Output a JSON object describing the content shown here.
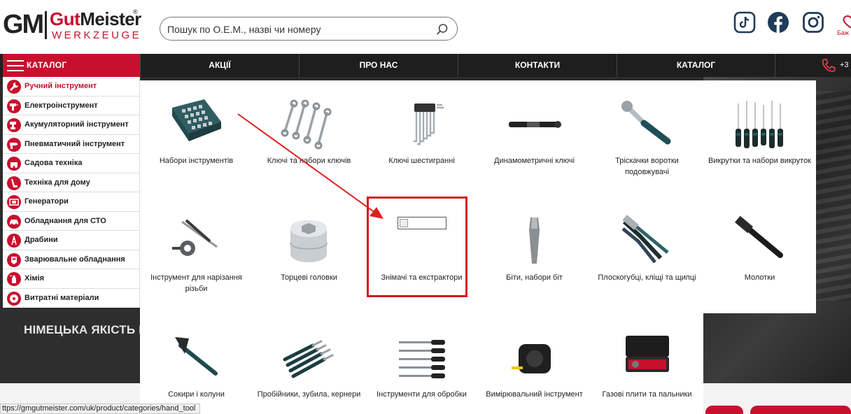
{
  "header": {
    "logo": {
      "gm": "GM",
      "brand_a": "Gut",
      "brand_b": "Meister",
      "reg": "®",
      "sub": "WERKZEUGE"
    },
    "search": {
      "placeholder": "Пошук по О.Е.М., назві чи номеру",
      "value": ""
    },
    "favorites_label": "Баж",
    "social": [
      "tiktok-icon",
      "facebook-icon",
      "instagram-icon"
    ]
  },
  "nav": {
    "catalog_button": "КАТАЛОГ",
    "items": [
      "АКЦІЇ",
      "ПРО НАС",
      "КОНТАКТИ",
      "КАТАЛОГ"
    ],
    "phone": "+3"
  },
  "banner": {
    "slogan": "НІМЕЦЬКА ЯКІСТЬ П"
  },
  "sidebar": {
    "items": [
      {
        "label": "Ручний інструмент",
        "active": true
      },
      {
        "label": "Електроінструмент"
      },
      {
        "label": "Акумуляторний інструмент"
      },
      {
        "label": "Пневматичний інструмент"
      },
      {
        "label": "Садова техніка"
      },
      {
        "label": "Техніка для дому"
      },
      {
        "label": "Генератори"
      },
      {
        "label": "Обладнання для СТО"
      },
      {
        "label": "Драбини"
      },
      {
        "label": "Зварювальне обладнання"
      },
      {
        "label": "Хімія"
      },
      {
        "label": "Витратні матеріали"
      }
    ]
  },
  "mega": {
    "tiles": [
      {
        "name": "Набори інструментів"
      },
      {
        "name": "Ключі та набори ключів"
      },
      {
        "name": "Ключі шестигранні"
      },
      {
        "name": "Динамометричні ключі"
      },
      {
        "name": "Тріскачки воротки подовжувачі"
      },
      {
        "name": "Викрутки та набори викруток"
      },
      {
        "name": "Інструмент для нарізання різьби"
      },
      {
        "name": "Торцеві головки"
      },
      {
        "name": "Знімачі та екстрактори"
      },
      {
        "name": "Біти, набори біт"
      },
      {
        "name": "Плоскогубці, кліщі та щипці"
      },
      {
        "name": "Молотки"
      },
      {
        "name": "Сокири і колуни"
      },
      {
        "name": "Пробійники, зубила, кернери"
      },
      {
        "name": "Інструменти для обробки"
      },
      {
        "name": "Вимірювальний інструмент"
      },
      {
        "name": "Газові плити та пальники"
      }
    ]
  },
  "status_bar": {
    "url": "ttps://gmgutmeister.com/uk/product/categories/hand_tool"
  },
  "colors": {
    "accent": "#c8102e",
    "nav_bg": "#1e1e1e",
    "highlight": "#d6161b"
  }
}
